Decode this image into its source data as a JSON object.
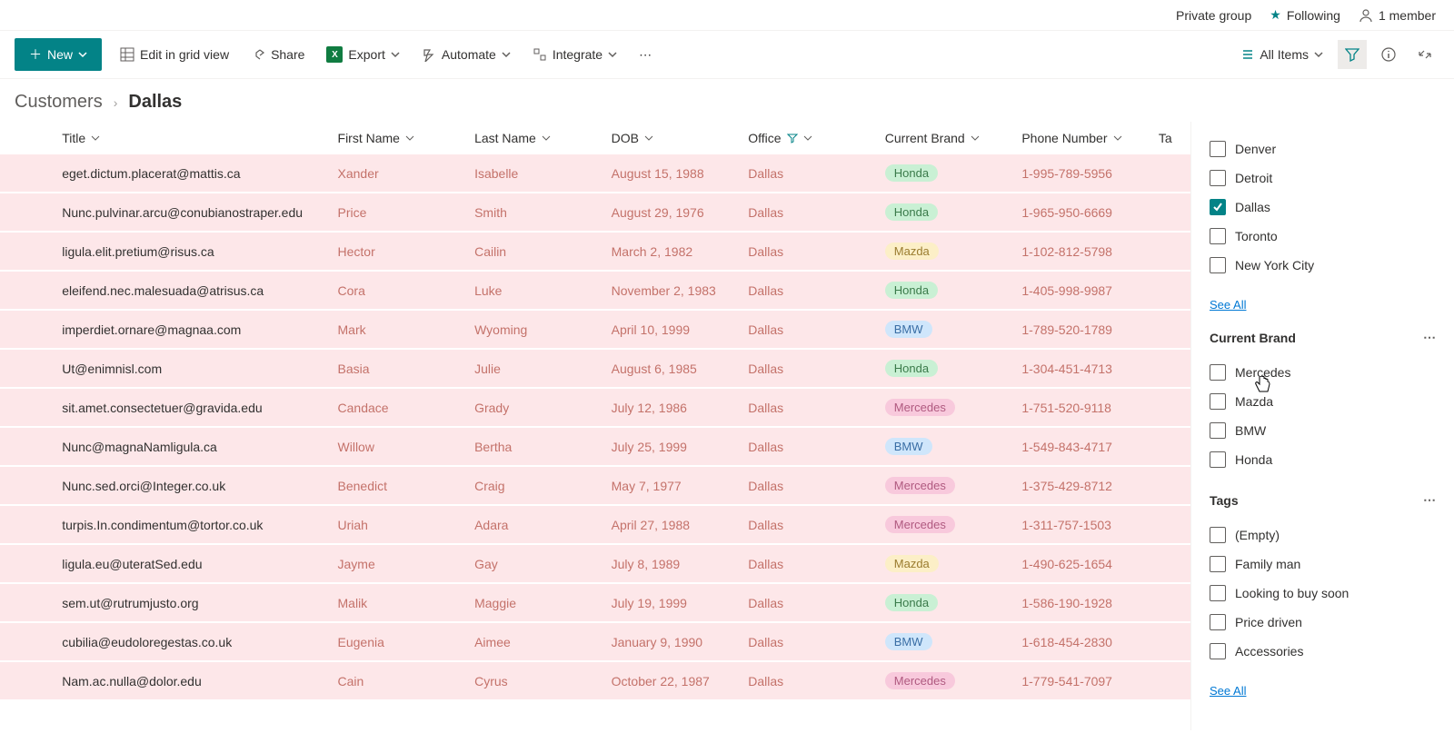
{
  "top_bar": {
    "group_type": "Private group",
    "following": "Following",
    "members": "1 member"
  },
  "toolbar": {
    "new": "New",
    "edit_grid": "Edit in grid view",
    "share": "Share",
    "export": "Export",
    "automate": "Automate",
    "integrate": "Integrate",
    "view": "All Items"
  },
  "breadcrumb": {
    "parent": "Customers",
    "current": "Dallas"
  },
  "columns": {
    "title": "Title",
    "first_name": "First Name",
    "last_name": "Last Name",
    "dob": "DOB",
    "office": "Office",
    "current_brand": "Current Brand",
    "phone": "Phone Number",
    "tags": "Ta"
  },
  "rows": [
    {
      "title": "eget.dictum.placerat@mattis.ca",
      "fn": "Xander",
      "ln": "Isabelle",
      "dob": "August 15, 1988",
      "office": "Dallas",
      "brand": "Honda",
      "phone": "1-995-789-5956"
    },
    {
      "title": "Nunc.pulvinar.arcu@conubianostraper.edu",
      "fn": "Price",
      "ln": "Smith",
      "dob": "August 29, 1976",
      "office": "Dallas",
      "brand": "Honda",
      "phone": "1-965-950-6669"
    },
    {
      "title": "ligula.elit.pretium@risus.ca",
      "fn": "Hector",
      "ln": "Cailin",
      "dob": "March 2, 1982",
      "office": "Dallas",
      "brand": "Mazda",
      "phone": "1-102-812-5798"
    },
    {
      "title": "eleifend.nec.malesuada@atrisus.ca",
      "fn": "Cora",
      "ln": "Luke",
      "dob": "November 2, 1983",
      "office": "Dallas",
      "brand": "Honda",
      "phone": "1-405-998-9987"
    },
    {
      "title": "imperdiet.ornare@magnaa.com",
      "fn": "Mark",
      "ln": "Wyoming",
      "dob": "April 10, 1999",
      "office": "Dallas",
      "brand": "BMW",
      "phone": "1-789-520-1789"
    },
    {
      "title": "Ut@enimnisl.com",
      "fn": "Basia",
      "ln": "Julie",
      "dob": "August 6, 1985",
      "office": "Dallas",
      "brand": "Honda",
      "phone": "1-304-451-4713"
    },
    {
      "title": "sit.amet.consectetuer@gravida.edu",
      "fn": "Candace",
      "ln": "Grady",
      "dob": "July 12, 1986",
      "office": "Dallas",
      "brand": "Mercedes",
      "phone": "1-751-520-9118"
    },
    {
      "title": "Nunc@magnaNamligula.ca",
      "fn": "Willow",
      "ln": "Bertha",
      "dob": "July 25, 1999",
      "office": "Dallas",
      "brand": "BMW",
      "phone": "1-549-843-4717"
    },
    {
      "title": "Nunc.sed.orci@Integer.co.uk",
      "fn": "Benedict",
      "ln": "Craig",
      "dob": "May 7, 1977",
      "office": "Dallas",
      "brand": "Mercedes",
      "phone": "1-375-429-8712"
    },
    {
      "title": "turpis.In.condimentum@tortor.co.uk",
      "fn": "Uriah",
      "ln": "Adara",
      "dob": "April 27, 1988",
      "office": "Dallas",
      "brand": "Mercedes",
      "phone": "1-311-757-1503"
    },
    {
      "title": "ligula.eu@uteratSed.edu",
      "fn": "Jayme",
      "ln": "Gay",
      "dob": "July 8, 1989",
      "office": "Dallas",
      "brand": "Mazda",
      "phone": "1-490-625-1654"
    },
    {
      "title": "sem.ut@rutrumjusto.org",
      "fn": "Malik",
      "ln": "Maggie",
      "dob": "July 19, 1999",
      "office": "Dallas",
      "brand": "Honda",
      "phone": "1-586-190-1928"
    },
    {
      "title": "cubilia@eudoloregestas.co.uk",
      "fn": "Eugenia",
      "ln": "Aimee",
      "dob": "January 9, 1990",
      "office": "Dallas",
      "brand": "BMW",
      "phone": "1-618-454-2830"
    },
    {
      "title": "Nam.ac.nulla@dolor.edu",
      "fn": "Cain",
      "ln": "Cyrus",
      "dob": "October 22, 1987",
      "office": "Dallas",
      "brand": "Mercedes",
      "phone": "1-779-541-7097"
    }
  ],
  "filter_panel": {
    "offices": [
      {
        "label": "Denver",
        "checked": false
      },
      {
        "label": "Detroit",
        "checked": false
      },
      {
        "label": "Dallas",
        "checked": true
      },
      {
        "label": "Toronto",
        "checked": false
      },
      {
        "label": "New York City",
        "checked": false
      }
    ],
    "see_all": "See All",
    "brand_title": "Current Brand",
    "brands": [
      {
        "label": "Mercedes",
        "checked": false
      },
      {
        "label": "Mazda",
        "checked": false
      },
      {
        "label": "BMW",
        "checked": false
      },
      {
        "label": "Honda",
        "checked": false
      }
    ],
    "tags_title": "Tags",
    "tags": [
      {
        "label": "(Empty)",
        "checked": false
      },
      {
        "label": "Family man",
        "checked": false
      },
      {
        "label": "Looking to buy soon",
        "checked": false
      },
      {
        "label": "Price driven",
        "checked": false
      },
      {
        "label": "Accessories",
        "checked": false
      }
    ]
  }
}
